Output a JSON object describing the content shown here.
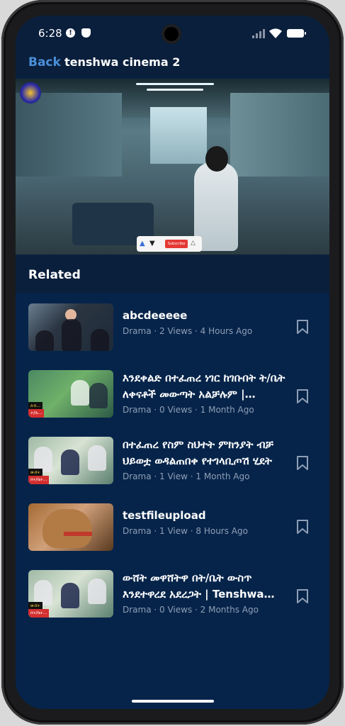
{
  "status_bar": {
    "time": "6:28"
  },
  "header": {
    "back_label": "Back",
    "title": "tenshwa cinema 2"
  },
  "video": {
    "overlay": {
      "subscribe_label": "Subscribe"
    }
  },
  "related": {
    "title": "Related",
    "items": [
      {
        "title": "abcdeeeee",
        "meta": "Drama · 2 Views · 4 Hours Ago"
      },
      {
        "title": "እንደቀልድ በተፈጠረ ነገር ከገቡበት ት/ቤት ለቀናቶች መውጣት አልቻሉም | Tenshwa Cinema",
        "meta": "Drama · 0 Views · 1 Month Ago"
      },
      {
        "title": "በተፈጠረ የስም ስህተት ምክንያት ብቻ ህይወቷ ወዳልጠበቀ የተገላቢጦሽ ሂደት",
        "meta": "Drama · 1 View · 1 Month Ago"
      },
      {
        "title": "testfileupload",
        "meta": "Drama · 1 View · 8 Hours Ago"
      },
      {
        "title": "ውሸት መዋሸትዋ በት/ቤት ውስጥ እንደተዋረደ አደረጋት | Tenshwa Cinema",
        "meta": "Drama · 0 Views · 2 Months Ago"
      }
    ]
  },
  "colors": {
    "background": "#06244a",
    "header": "#0a1f3c",
    "accent": "#4a90d9",
    "meta_text": "#8f9fb6"
  },
  "icons": {
    "status": [
      "alert-icon",
      "shield-icon",
      "signal-icon",
      "wifi-icon",
      "battery-icon"
    ],
    "list": "bookmark-icon"
  }
}
